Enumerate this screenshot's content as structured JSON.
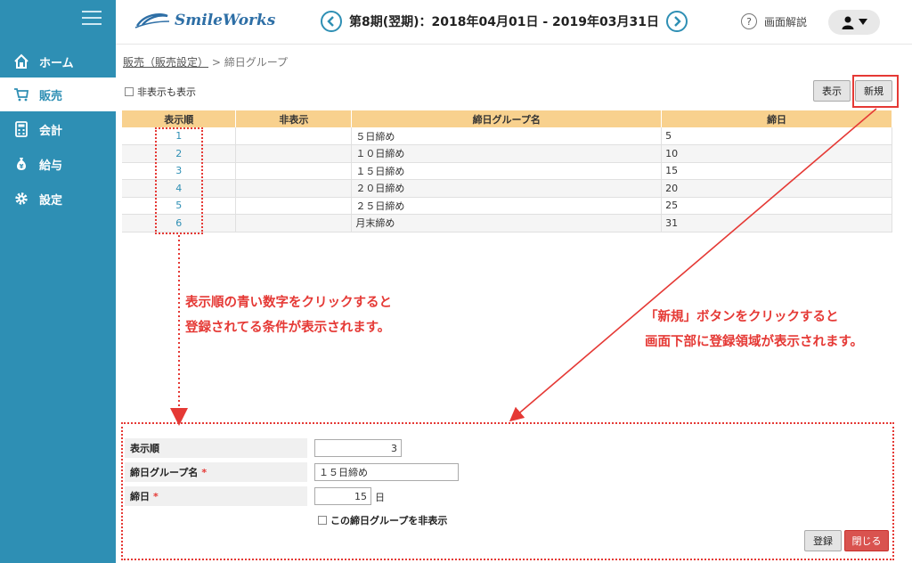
{
  "app": {
    "logo": "SmileWorks"
  },
  "header": {
    "period": "第8期(翌期)：2018年04月01日 - 2019年03月31日",
    "prev_icon": "chevron-left-icon",
    "next_icon": "chevron-right-icon",
    "help_label": "画面解説",
    "help_icon": "?"
  },
  "sidebar": {
    "items": [
      {
        "label": "ホーム",
        "icon": "home-icon"
      },
      {
        "label": "販売",
        "icon": "cart-icon"
      },
      {
        "label": "会計",
        "icon": "calculator-icon"
      },
      {
        "label": "給与",
        "icon": "money-bag-icon"
      },
      {
        "label": "設定",
        "icon": "gear-icon"
      }
    ]
  },
  "breadcrumb": {
    "parent": "販売（販売設定）",
    "sep": ">",
    "current": "締日グループ"
  },
  "toolbar": {
    "show_hidden": "非表示も表示",
    "display_btn": "表示",
    "new_btn": "新規"
  },
  "table": {
    "headers": [
      "表示順",
      "非表示",
      "締日グループ名",
      "締日"
    ],
    "rows": [
      {
        "order": "1",
        "hidden": "",
        "name": "５日締め",
        "day": "5"
      },
      {
        "order": "2",
        "hidden": "",
        "name": "１０日締め",
        "day": "10"
      },
      {
        "order": "3",
        "hidden": "",
        "name": "１５日締め",
        "day": "15"
      },
      {
        "order": "4",
        "hidden": "",
        "name": "２０日締め",
        "day": "20"
      },
      {
        "order": "5",
        "hidden": "",
        "name": "２５日締め",
        "day": "25"
      },
      {
        "order": "6",
        "hidden": "",
        "name": "月末締め",
        "day": "31"
      }
    ]
  },
  "annotations": {
    "left_line1": "表示順の青い数字をクリックすると",
    "left_line2": "登録されてる条件が表示されます。",
    "right_line1": "「新規」ボタンをクリックすると",
    "right_line2": "画面下部に登録領域が表示されます。"
  },
  "form": {
    "order_label": "表示順",
    "order_value": "3",
    "name_label": "締日グループ名",
    "name_value": "１５日締め",
    "day_label": "締日",
    "day_value": "15",
    "day_unit": "日",
    "required_mark": "*",
    "hide_label": "この締日グループを非表示",
    "register_btn": "登録",
    "close_btn": "閉じる"
  },
  "colors": {
    "brand": "#2e8fb4",
    "accent_red": "#e53935",
    "table_header": "#f8d18e",
    "close_btn": "#d9534f"
  }
}
